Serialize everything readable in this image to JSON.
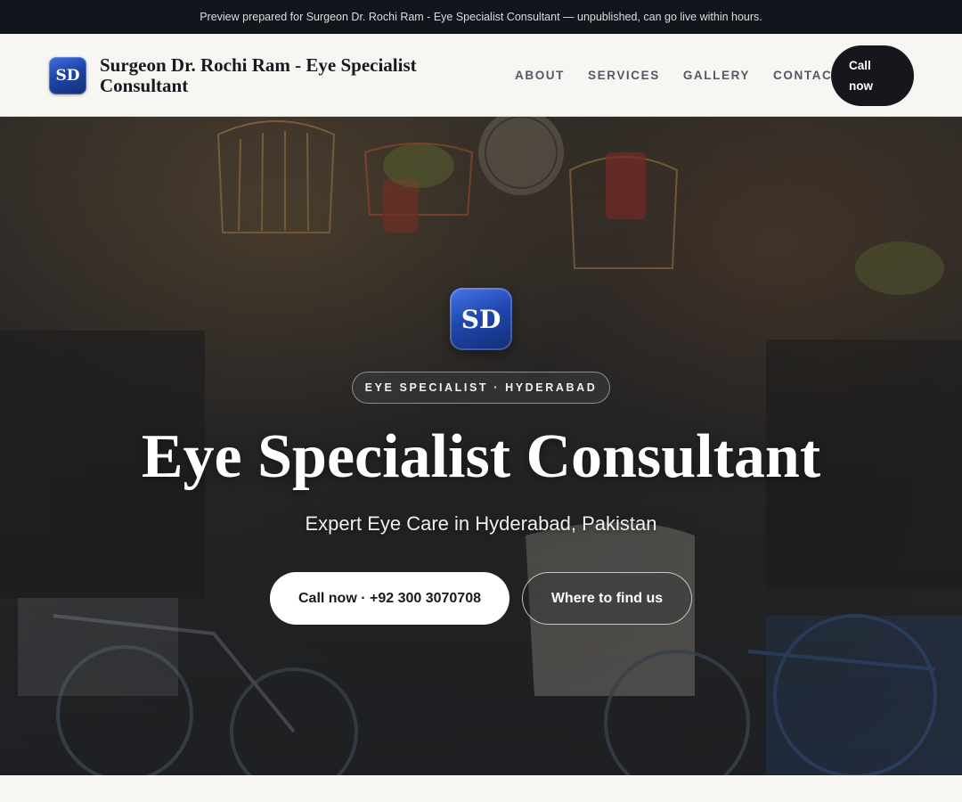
{
  "preview_bar": {
    "text": "Preview prepared for Surgeon Dr. Rochi Ram - Eye Specialist Consultant — unpublished, can go live within hours."
  },
  "header": {
    "logo_initials": "SD",
    "brand_name": "Surgeon Dr. Rochi Ram - Eye Specialist Consultant",
    "nav": [
      {
        "label": "ABOUT"
      },
      {
        "label": "SERVICES"
      },
      {
        "label": "GALLERY"
      },
      {
        "label": "CONTACT"
      }
    ],
    "call_button": "Call now"
  },
  "hero": {
    "logo_initials": "SD",
    "badge": "EYE SPECIALIST · HYDERABAD",
    "title": "Eye Specialist Consultant",
    "subtitle": "Expert Eye Care in Hyderabad, Pakistan",
    "primary_cta": "Call now · +92 300 3070708",
    "secondary_cta": "Where to find us",
    "background_image": "shop-interior-with-hanging-birdcages-clocks-and-bicycles"
  },
  "colors": {
    "preview_bar_bg": "#12151b",
    "header_bg": "#f7f6f2",
    "logo_blue": "#2148b0",
    "dark_button": "#15171c",
    "hero_text": "#ffffff"
  }
}
